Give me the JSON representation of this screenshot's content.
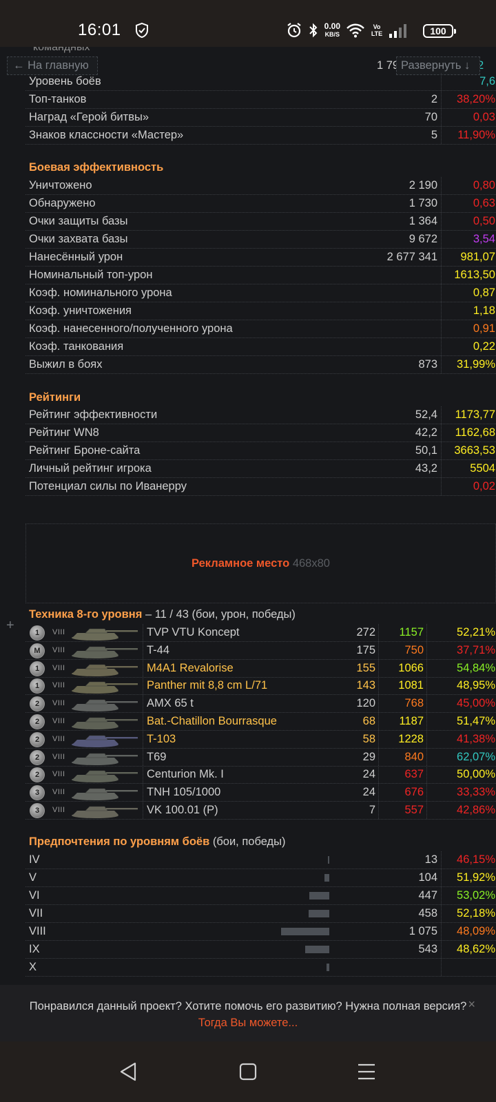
{
  "status": {
    "time": "16:01",
    "net_speed": "0.00",
    "net_unit": "KB/S",
    "volte": "Vo LTE",
    "battery": "100"
  },
  "nav_floating": {
    "back": "← На главную",
    "expand": "Развернуть ↓",
    "partial_label": "командных",
    "partial_value": "1 79",
    "partial_value2": "2"
  },
  "stats_top": [
    {
      "label": "Уровень боёв",
      "v1": "",
      "v2": "7,6",
      "color": "teal"
    },
    {
      "label": "Топ-танков",
      "v1": "2",
      "v2": "38,20%",
      "color": "red"
    },
    {
      "label": "Наград «Герой битвы»",
      "v1": "70",
      "v2": "0,03",
      "color": "red"
    },
    {
      "label": "Знаков классности «Мастер»",
      "v1": "5",
      "v2": "11,90%",
      "color": "red"
    }
  ],
  "combat": {
    "title": "Боевая эффективность",
    "rows": [
      {
        "label": "Уничтожено",
        "v1": "2 190",
        "v2": "0,80",
        "color": "red"
      },
      {
        "label": "Обнаружено",
        "v1": "1 730",
        "v2": "0,63",
        "color": "red"
      },
      {
        "label": "Очки защиты базы",
        "v1": "1 364",
        "v2": "0,50",
        "color": "red"
      },
      {
        "label": "Очки захвата базы",
        "v1": "9 672",
        "v2": "3,54",
        "color": "purple"
      },
      {
        "label": "Нанесённый урон",
        "v1": "2 677 341",
        "v2": "981,07",
        "color": "yellow"
      },
      {
        "label": "Номинальный топ-урон",
        "v1": "",
        "v2": "1613,50",
        "color": "yellow"
      },
      {
        "label": "Коэф. номинального урона",
        "v1": "",
        "v2": "0,87",
        "color": "yellow"
      },
      {
        "label": "Коэф. уничтожения",
        "v1": "",
        "v2": "1,18",
        "color": "yellow"
      },
      {
        "label": "Коэф. нанесенного/полученного урона",
        "v1": "",
        "v2": "0,91",
        "color": "orange"
      },
      {
        "label": "Коэф. танкования",
        "v1": "",
        "v2": "0,22",
        "color": "yellow"
      },
      {
        "label": "Выжил в боях",
        "v1": "873",
        "v2": "31,99%",
        "color": "yellow"
      }
    ]
  },
  "ratings": {
    "title": "Рейтинги",
    "rows": [
      {
        "label": "Рейтинг эффективности",
        "v1": "52,4",
        "v2": "1173,77",
        "color": "yellow"
      },
      {
        "label": "Рейтинг WN8",
        "v1": "42,2",
        "v2": "1162,68",
        "color": "yellow"
      },
      {
        "label": "Рейтинг Броне-сайта",
        "v1": "50,1",
        "v2": "3663,53",
        "color": "yellow"
      },
      {
        "label": "Личный рейтинг игрока",
        "v1": "43,2",
        "v2": "5504",
        "color": "yellow"
      },
      {
        "label": "Потенциал силы по Иванерру",
        "v1": "",
        "v2": "0,02",
        "color": "red"
      }
    ]
  },
  "ad": {
    "main": "Рекламное место",
    "size": "468x80"
  },
  "tanks": {
    "title": "Техника 8-го уровня",
    "subtitle": " – 11 / 43 (бои, урон, победы)",
    "rows": [
      {
        "badge": "1",
        "tier": "VIII",
        "name": "TVP VTU Koncept",
        "gold": false,
        "battles": "272",
        "dmg": "1157",
        "dmg_color": "lgreen",
        "win": "52,21%",
        "win_color": "yellow",
        "hue": "#6b6b58"
      },
      {
        "badge": "M",
        "tier": "VIII",
        "name": "T-44",
        "gold": false,
        "battles": "175",
        "dmg": "750",
        "dmg_color": "orange",
        "win": "37,71%",
        "win_color": "red",
        "hue": "#5f6358"
      },
      {
        "badge": "1",
        "tier": "VIII",
        "name": "M4A1 Revalorise",
        "gold": true,
        "battles": "155",
        "dmg": "1066",
        "dmg_color": "yellow",
        "win": "54,84%",
        "win_color": "lgreen",
        "hue": "#6a6650"
      },
      {
        "badge": "1",
        "tier": "VIII",
        "name": "Panther mit 8,8 cm L/71",
        "gold": true,
        "battles": "143",
        "dmg": "1081",
        "dmg_color": "yellow",
        "win": "48,95%",
        "win_color": "yellow",
        "hue": "#6a6850"
      },
      {
        "badge": "2",
        "tier": "VIII",
        "name": "AMX 65 t",
        "gold": false,
        "battles": "120",
        "dmg": "768",
        "dmg_color": "orange",
        "win": "45,00%",
        "win_color": "red",
        "hue": "#5f6260"
      },
      {
        "badge": "2",
        "tier": "VIII",
        "name": "Bat.-Chatillon Bourrasque",
        "gold": true,
        "battles": "68",
        "dmg": "1187",
        "dmg_color": "yellow",
        "win": "51,47%",
        "win_color": "yellow",
        "hue": "#5e6155"
      },
      {
        "badge": "2",
        "tier": "VIII",
        "name": "T-103",
        "gold": true,
        "battles": "58",
        "dmg": "1228",
        "dmg_color": "yellow",
        "win": "41,38%",
        "win_color": "red",
        "hue": "#55587a"
      },
      {
        "badge": "2",
        "tier": "VIII",
        "name": "T69",
        "gold": false,
        "battles": "29",
        "dmg": "840",
        "dmg_color": "orange",
        "win": "62,07%",
        "win_color": "teal",
        "hue": "#5f6360"
      },
      {
        "badge": "2",
        "tier": "VIII",
        "name": "Centurion Mk. I",
        "gold": false,
        "battles": "24",
        "dmg": "637",
        "dmg_color": "red",
        "win": "50,00%",
        "win_color": "yellow",
        "hue": "#5f6358"
      },
      {
        "badge": "3",
        "tier": "VIII",
        "name": "TNH 105/1000",
        "gold": false,
        "battles": "24",
        "dmg": "676",
        "dmg_color": "red",
        "win": "33,33%",
        "win_color": "red",
        "hue": "#626560"
      },
      {
        "badge": "3",
        "tier": "VIII",
        "name": "VK 100.01 (P)",
        "gold": false,
        "battles": "7",
        "dmg": "557",
        "dmg_color": "red",
        "win": "42,86%",
        "win_color": "red",
        "hue": "#66655a"
      }
    ]
  },
  "levels": {
    "title": "Предпочтения по уровням боёв",
    "subtitle": " (бои, победы)",
    "rows": [
      {
        "label": "IV",
        "battles": "13",
        "share": 0.012,
        "win": "46,15%",
        "color": "red"
      },
      {
        "label": "V",
        "battles": "104",
        "share": 0.097,
        "win": "51,92%",
        "color": "yellow"
      },
      {
        "label": "VI",
        "battles": "447",
        "share": 0.416,
        "win": "53,02%",
        "color": "lgreen"
      },
      {
        "label": "VII",
        "battles": "458",
        "share": 0.426,
        "win": "52,18%",
        "color": "yellow"
      },
      {
        "label": "VIII",
        "battles": "1 075",
        "share": 1.0,
        "win": "48,09%",
        "color": "orange"
      },
      {
        "label": "IX",
        "battles": "543",
        "share": 0.505,
        "win": "48,62%",
        "color": "yellow"
      },
      {
        "label": "X",
        "battles": "",
        "share": 0.05,
        "win": "",
        "color": "red"
      }
    ]
  },
  "donate": {
    "question": "Понравился данный проект? Хотите помочь его развитию? Нужна полная версия?",
    "link": "Тогда Вы можете...",
    "close": "×"
  }
}
